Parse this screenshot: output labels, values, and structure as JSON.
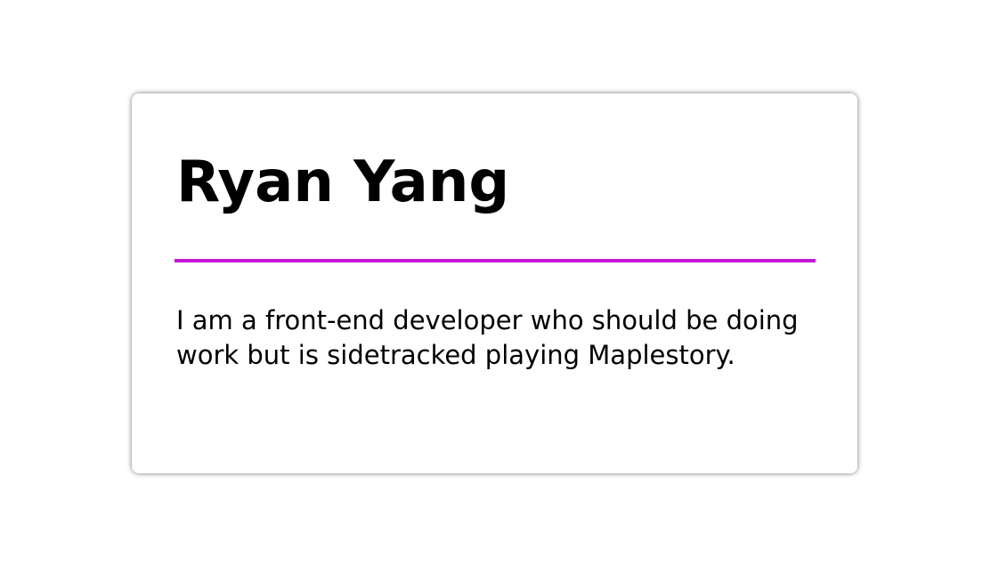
{
  "profile": {
    "name": "Ryan Yang",
    "bio": "I am a front-end developer who should be doing work but is sidetracked playing Maplestory."
  },
  "colors": {
    "accent": "#c416d4",
    "text": "#000000",
    "card_background": "#ffffff"
  }
}
